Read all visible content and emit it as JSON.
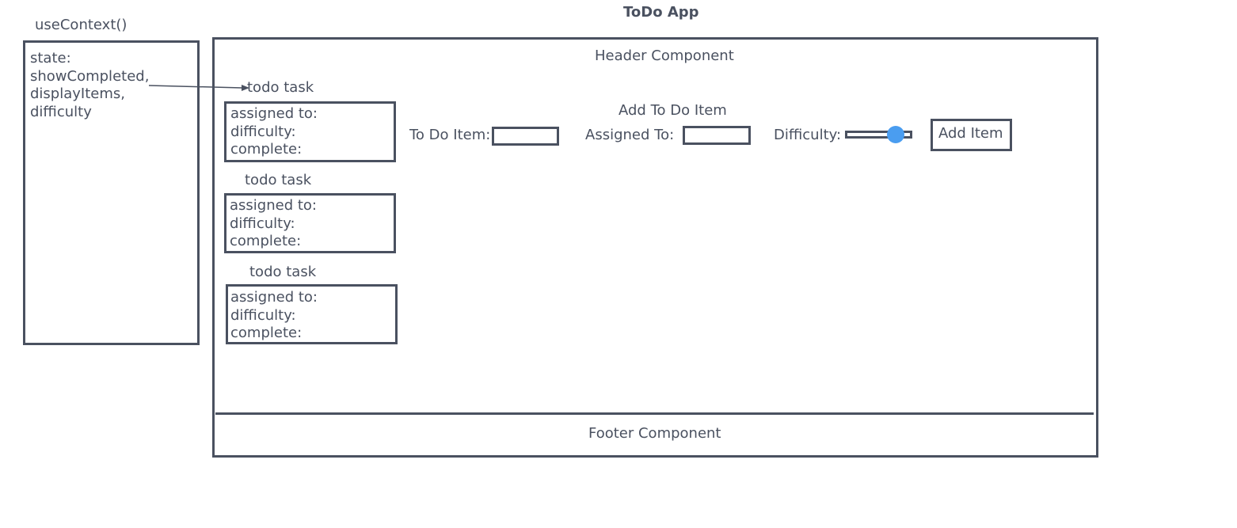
{
  "app_title": "ToDo App",
  "context": {
    "label": "useContext()",
    "state_lines": [
      "state:",
      "showCompleted,",
      "displayItems,",
      "difficulty"
    ]
  },
  "header": {
    "label": "Header Component"
  },
  "tasks": [
    {
      "title": "todo task",
      "fields": [
        "assigned to:",
        "difficulty:",
        "complete:"
      ]
    },
    {
      "title": "todo task",
      "fields": [
        "assigned to:",
        "difficulty:",
        "complete:"
      ]
    },
    {
      "title": "todo task",
      "fields": [
        "assigned to:",
        "difficulty:",
        "complete:"
      ]
    }
  ],
  "form": {
    "title": "Add To Do Item",
    "todo_item_label": "To Do Item:",
    "assigned_to_label": "Assigned To:",
    "difficulty_label": "Difficulty:",
    "difficulty_level": 0.75,
    "add_button_label": "Add Item"
  },
  "footer": {
    "label": "Footer Component"
  },
  "colors": {
    "stroke": "#4a5160",
    "slider_thumb": "#4a9df0"
  }
}
